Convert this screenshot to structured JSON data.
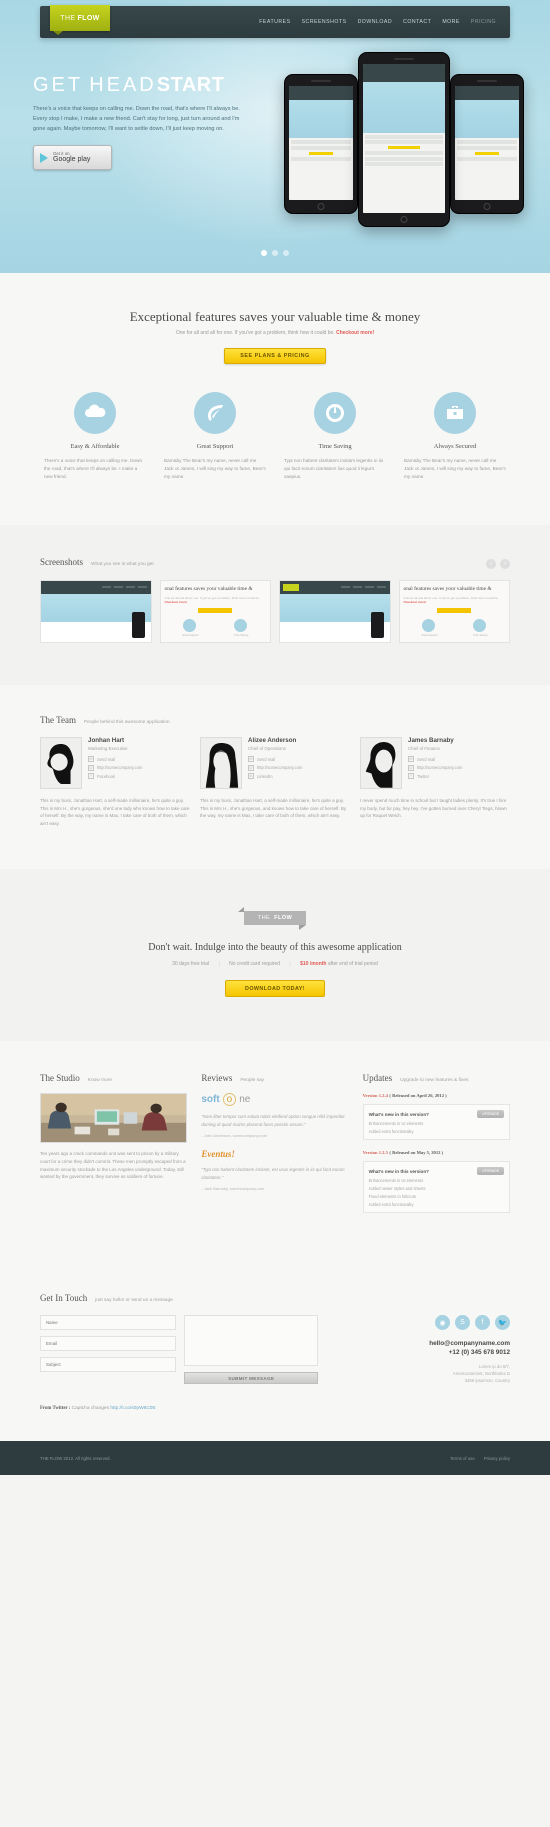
{
  "nav": {
    "logo_top": "THE",
    "logo_bottom": "FLOW",
    "links": [
      {
        "label": "FEATURES"
      },
      {
        "label": "SCREENSHOTS"
      },
      {
        "label": "DOWNLOAD"
      },
      {
        "label": "CONTACT"
      },
      {
        "label": "MORE"
      },
      {
        "label": "PRICING"
      }
    ]
  },
  "hero": {
    "title_light": "GET",
    "title_mid": "HEAD",
    "title_bold": "START",
    "paragraph": "There's a voice that keeps on calling me. Down the road, that's where I'll always be. Every stop I make, I make a new friend. Can't stay for long, just turn around and I'm gone again. Maybe tomorrow, I'll want to settle down, I'll just keep moving on.",
    "button_small": "Get it on",
    "button_big": "Google play",
    "slider_dots": 3,
    "active_dot": 0
  },
  "features": {
    "heading": "Exceptional features saves your valuable time & money",
    "sub_plain": "One for all and all for one. If you've got a problem, think how it could be.",
    "sub_link": "Checkout more!",
    "cta_label": "SEE PLANS & PRICING",
    "items": [
      {
        "icon": "cloud-icon",
        "title": "Easy & Affordable",
        "desc": "There's a voice that keeps on calling me. Down the road, that's where I'll always be. I make a new friend."
      },
      {
        "icon": "leaf-icon",
        "title": "Great Support",
        "desc": "Barnaby The Bear's my name, never call me Jack or James, I will sing my way to fame, Bear's my name."
      },
      {
        "icon": "clock-icon",
        "title": "Time Saving",
        "desc": "Typi non habent claritatem insitam legentis in iis qui facit eorum claritatem lius quod ii legunt saepius."
      },
      {
        "icon": "briefcase-icon",
        "title": "Always Secured",
        "desc": "Barnaby The Bear's my name, never call me Jack or James, I will sing my way to fame, Bear's my name."
      }
    ]
  },
  "screenshots": {
    "title": "Screenshots",
    "subtitle": "What you see is what you get",
    "prev_icon": "chevron-left-icon",
    "next_icon": "chevron-right-icon",
    "slides": [
      {
        "type": "site-dark"
      },
      {
        "type": "feature-page",
        "heading": "onal features saves your valuable time &",
        "sub": "One for all and all for one. If you've got a problem, think how it could be.",
        "sub_link": "Checkout more!",
        "labels": [
          "Great Support",
          "Time Saving"
        ]
      },
      {
        "type": "site-hero",
        "heading": "HEADSTART"
      },
      {
        "type": "feature-page",
        "heading": "onal features saves your valuable time &",
        "sub": "One for all and all for one. If you've got a problem, think how it could be.",
        "sub_link": "Checkout more!",
        "labels": [
          "Great Support",
          "Time Saving"
        ]
      }
    ]
  },
  "team": {
    "title": "The Team",
    "subtitle": "People behind this awesome application",
    "members": [
      {
        "name": "Jonhan Hart",
        "role": "Marketing Executive",
        "links": [
          {
            "icon": "mail-icon",
            "label": "Send mail"
          },
          {
            "icon": "link-icon",
            "label": "http://somecompany.com"
          },
          {
            "icon": "facebook-icon",
            "label": "Facebook"
          }
        ],
        "bio": "This is my boss, Jonathan Hart, a self-made millionaire, he's quite a guy. This is Mrs H., she's gorgeous, she'd one lady who knows how to take care of herself. By the way, my name is Max, I take care of both of them, which ain't easy."
      },
      {
        "name": "Alizee Anderson",
        "role": "Chief of Operations",
        "links": [
          {
            "icon": "mail-icon",
            "label": "Send mail"
          },
          {
            "icon": "link-icon",
            "label": "http://somecompany.com"
          },
          {
            "icon": "linkedin-icon",
            "label": "LinkedIn"
          }
        ],
        "bio": "This is my boss, Jonathan Hart, a self-made millionaire, he's quite a guy. This is Mrs H., she's gorgeous, and knows how to take care of herself. By the way, my name is Max, I take care of both of them, which ain't easy."
      },
      {
        "name": "James Barnaby",
        "role": "Chief of Finance",
        "links": [
          {
            "icon": "mail-icon",
            "label": "Send mail"
          },
          {
            "icon": "link-icon",
            "label": "http://somecompany.com"
          },
          {
            "icon": "twitter-icon",
            "label": "Twitter"
          }
        ],
        "bio": "I never spend much time in school but I taught ladies plenty. It's true I hire my body, but for pay, hey hey. I've gotten burned over Cheryl Tiegs, blown up for Raquel Welch."
      }
    ]
  },
  "cta": {
    "ribbon_top": "THE",
    "ribbon_bottom": "FLOW",
    "heading": "Don't wait. Indulge into the beauty of this awesome application",
    "point1": "30 days free trial",
    "point2": "No credit card required",
    "price": "$10 /month",
    "point3": "after end of trial period",
    "button": "DOWNLOAD TODAY!"
  },
  "info": {
    "studio": {
      "title": "The Studio",
      "subtitle": "Know more",
      "paragraph": "Ten years ago a crack commando unit was sent to prison by a military court for a crime they didn't commit. These men promptly escaped from a maximum security stockade to the Los Angeles underground. Today, still wanted by the government, they survive as soldiers of fortune."
    },
    "reviews": {
      "title": "Reviews",
      "subtitle": "People say",
      "logo1_a": "soft",
      "logo1_b": "o",
      "logo1_c": "ne",
      "quote1": "\"Nam liber tempor cum soluta nobis eleifend option congue nihil imperdiet doming id quod mazim placerat facer possim assum.\"",
      "author1": "- John Anderson, somecompany.com",
      "logo2": "Eventus!",
      "quote2": "\"Typi non habent claritatem insitam, est usus legentis in iis qui facit eorum claritatem.\"",
      "author2": "- Jack Barnaby, somecompany.com"
    },
    "updates": {
      "title": "Updates",
      "subtitle": "Upgrade to new features & fixes",
      "entries": [
        {
          "version": "Version 1.2.4",
          "released": "( Released on April 26, 2012 )",
          "box_title": "What's new in this version?",
          "upgrade_label": "UPGRADE",
          "items": [
            "Enhancements in UI elements",
            "Added extra functionality"
          ]
        },
        {
          "version": "Version 1.2.5",
          "released": "( Released on May 5, 2012 )",
          "box_title": "What's new in this version?",
          "upgrade_label": "UPGRADE",
          "items": [
            "Enhancements in UI elements",
            "Added newer styles and sheets",
            "Fixed elements in fullcrum",
            "Added extra functionality"
          ]
        }
      ]
    }
  },
  "contact": {
    "title": "Get In Touch",
    "subtitle": "just say hello! or send us a message",
    "name_placeholder": "Name",
    "email_placeholder": "Email",
    "subject_placeholder": "Subject",
    "message_placeholder": "",
    "submit_label": "SUBMIT MESSAGE",
    "socials": [
      {
        "icon": "dribbble-icon",
        "glyph": "◉"
      },
      {
        "icon": "skype-icon",
        "glyph": "S"
      },
      {
        "icon": "facebook-icon",
        "glyph": "f"
      },
      {
        "icon": "twitter-icon",
        "glyph": "t"
      }
    ],
    "email": "hello@companyname.com",
    "phone": "+12 (0) 345 678 9012",
    "address_line1": "Lorem ip do 5/7,",
    "address_line2": "Ametconsecte5, Northbolex D",
    "address_line3": "3456 ipsumcto, Country"
  },
  "twitter": {
    "label": "From Twitter :",
    "text": "Captcha changes",
    "link": "http://t.co/s0pW6C0E"
  },
  "footer": {
    "copyright": "THE FLOW 2012. All rights reserved.",
    "links": [
      {
        "label": "Terms of use"
      },
      {
        "label": "Privacy policy"
      }
    ]
  },
  "colors": {
    "accent_blue": "#a6d2e2",
    "accent_yellow": "#f5c400",
    "logo_green": "#c6d41e",
    "dark": "#2e3c3f",
    "red": "#e05b55"
  }
}
